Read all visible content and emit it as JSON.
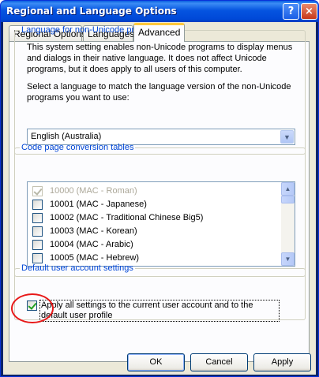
{
  "window": {
    "title": "Regional and Language Options"
  },
  "titlebar": {
    "help_glyph": "?",
    "close_glyph": "×"
  },
  "tabs": [
    {
      "label": "Regional Options"
    },
    {
      "label": "Languages"
    },
    {
      "label": "Advanced"
    }
  ],
  "non_unicode": {
    "legend": "Language for non-Unicode programs",
    "description": "This system setting enables non-Unicode programs to display menus and dialogs in their native language. It does not affect Unicode programs, but it does apply to all users of this computer.",
    "prompt": "Select a language to match the language version of the non-Unicode programs you want to use:",
    "selected_language": "English (Australia)",
    "arrow_glyph": "▼"
  },
  "code_pages": {
    "legend": "Code page conversion tables",
    "items": [
      {
        "label": "10000 (MAC - Roman)",
        "checked": true,
        "disabled": true
      },
      {
        "label": "10001 (MAC - Japanese)",
        "checked": false,
        "disabled": false
      },
      {
        "label": "10002 (MAC - Traditional Chinese Big5)",
        "checked": false,
        "disabled": false
      },
      {
        "label": "10003 (MAC - Korean)",
        "checked": false,
        "disabled": false
      },
      {
        "label": "10004 (MAC - Arabic)",
        "checked": false,
        "disabled": false
      },
      {
        "label": "10005 (MAC - Hebrew)",
        "checked": false,
        "disabled": false
      }
    ],
    "scroll_up_glyph": "▲",
    "scroll_down_glyph": "▼"
  },
  "default_user": {
    "legend": "Default user account settings",
    "apply_all_label": "Apply all settings to the current user account and to the default user profile",
    "apply_all_checked": true
  },
  "buttons": {
    "ok": "OK",
    "cancel": "Cancel",
    "apply": "Apply"
  },
  "colors": {
    "accent_legend": "#0046d5",
    "tab_highlight": "#ffc83c",
    "annotation_circle": "#e81818"
  }
}
